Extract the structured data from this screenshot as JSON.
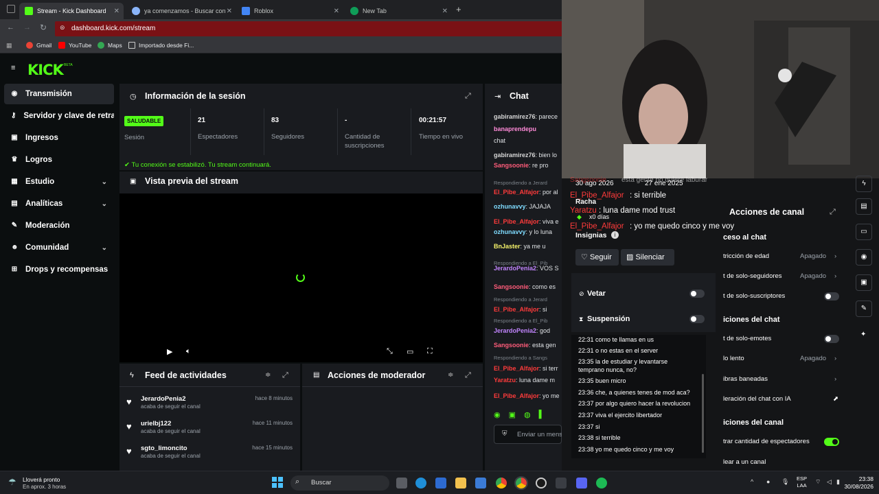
{
  "browser": {
    "tabs": [
      {
        "label": "Stream - Kick Dashboard",
        "icon": "kick-icon",
        "color": "#53fc18"
      },
      {
        "label": "ya comenzamos - Buscar con G",
        "icon": "search-icon",
        "color": "#8ab4f8"
      },
      {
        "label": "Roblox",
        "icon": "roblox-icon",
        "color": "#4285f4"
      },
      {
        "label": "New Tab",
        "icon": "newtab-icon",
        "color": "#0f9d58"
      }
    ],
    "url": "dashboard.kick.com/stream",
    "bookmarks": [
      "Gmail",
      "YouTube",
      "Maps",
      "Importado desde Fi..."
    ]
  },
  "kick": {
    "logo": "KICK",
    "logo_badge": "BETA",
    "nav": [
      {
        "label": "Transmisión",
        "icon": "broadcast-icon"
      },
      {
        "label": "Servidor y clave de retransmisión",
        "icon": "key-icon"
      },
      {
        "label": "Ingresos",
        "icon": "money-icon"
      },
      {
        "label": "Logros",
        "icon": "trophy-icon"
      },
      {
        "label": "Estudio",
        "icon": "studio-icon",
        "chev": "⌄"
      },
      {
        "label": "Analíticas",
        "icon": "chart-icon",
        "chev": "⌄"
      },
      {
        "label": "Moderación",
        "icon": "wrench-icon"
      },
      {
        "label": "Comunidad",
        "icon": "people-icon",
        "chev": "⌄"
      },
      {
        "label": "Drops y recompensas",
        "icon": "gift-icon"
      }
    ],
    "session": {
      "title": "Información de la sesión",
      "health_badge": "SALUDABLE",
      "health_label": "Sesión",
      "viewers_value": "21",
      "viewers_label": "Espectadores",
      "followers_value": "83",
      "followers_label": "Seguidores",
      "subs_value": "-",
      "subs_label": "Cantidad de suscripciones",
      "uptime_value": "00:21:57",
      "uptime_label": "Tiempo en vivo",
      "connection_msg": "Tu conexión se estabilizó. Tu stream continuará."
    },
    "preview": {
      "title": "Vista previa del stream"
    },
    "feed": {
      "title": "Feed de actividades",
      "items": [
        {
          "name": "JerardoPenia2",
          "sub": "acaba de seguir el canal",
          "time": "hace 8 minutos"
        },
        {
          "name": "urielbj122",
          "sub": "acaba de seguir el canal",
          "time": "hace 11 minutos"
        },
        {
          "name": "sgto_limoncito",
          "sub": "acaba de seguir el canal",
          "time": "hace 15 minutos"
        }
      ]
    },
    "mod_actions": {
      "title": "Acciones de moderador"
    },
    "chat": {
      "title": "Chat",
      "input_placeholder": "Enviar un mensaje",
      "messages": [
        {
          "user": "gabiramirez76",
          "text": ": parece",
          "color": "#d6d6d6",
          "reply": false
        },
        {
          "user": "banaprendepu",
          "text": "",
          "color": "#ff8ad8",
          "reply": false
        },
        {
          "user": "",
          "text": "chat",
          "color": "#d6d6d6",
          "reply": false
        },
        {
          "user": "gabiramirez76",
          "text": ": bien lo",
          "color": "#d6d6d6",
          "reply": false
        },
        {
          "user": "Sangsoonie",
          "text": ": re pro",
          "color": "#ff5c7a",
          "reply": false
        },
        {
          "user": "",
          "text": "Respondiendo a Jerard",
          "color": "#7c838a",
          "reply": true
        },
        {
          "user": "El_Pibe_Alfajor",
          "text": ": por al",
          "color": "#ff3b3b",
          "reply": false
        },
        {
          "user": "ozhunavvy",
          "text": ": JAJAJA",
          "color": "#7fdcff",
          "reply": false
        },
        {
          "user": "El_Pibe_Alfajor",
          "text": ": viva e",
          "color": "#ff3b3b",
          "reply": false
        },
        {
          "user": "ozhunavvy",
          "text": ": y lo luna",
          "color": "#7fdcff",
          "reply": false
        },
        {
          "user": "BnJaster",
          "text": ": ya me u",
          "color": "#f8f56b",
          "reply": false
        },
        {
          "user": "",
          "text": "Respondiendo a El_Pib",
          "color": "#7c838a",
          "reply": true
        },
        {
          "user": "JerardoPenia2",
          "text": ": VOS S",
          "color": "#c084fc",
          "reply": false
        },
        {
          "user": "Sangsoonie",
          "text": ": como es",
          "color": "#ff5c7a",
          "reply": false
        },
        {
          "user": "",
          "text": "Respondiendo a Jerard",
          "color": "#7c838a",
          "reply": true
        },
        {
          "user": "El_Pibe_Alfajor",
          "text": ": si",
          "color": "#ff3b3b",
          "reply": false
        },
        {
          "user": "",
          "text": "Respondiendo a El_Pib",
          "color": "#7c838a",
          "reply": true
        },
        {
          "user": "JerardoPenia2",
          "text": ": god",
          "color": "#c084fc",
          "reply": false
        },
        {
          "user": "Sangsoonie",
          "text": ": esta gen",
          "color": "#ff5c7a",
          "reply": false
        },
        {
          "user": "",
          "text": "Respondiendo a Sangs",
          "color": "#7c838a",
          "reply": true
        },
        {
          "user": "El_Pibe_Alfajor",
          "text": ": si terr",
          "color": "#ff3b3b",
          "reply": false
        },
        {
          "user": "Yaratzu",
          "text": ": luna dame m",
          "color": "#ff3b3b",
          "reply": false
        },
        {
          "user": "El_Pibe_Alfajor",
          "text": ": yo me",
          "color": "#ff3b3b",
          "reply": false
        }
      ]
    }
  },
  "user_card": {
    "dates": [
      "30 ago 2026",
      "27 ene 2025"
    ],
    "streak_label": "Racha",
    "streak_value": "x0 días",
    "badges_label": "Insignias",
    "follow_label": "Seguir",
    "silence_label": "Silenciar",
    "ban_label": "Vetar",
    "suspend_label": "Suspensión",
    "overlay_msgs": [
      {
        "user": "Sangsoonie",
        "text": "esta gente no quiere laburar"
      },
      {
        "user": "El_Pibe_Alfajor",
        "text": ": si terrible"
      },
      {
        "user": "Yaratzu",
        "text": ": luna dame mod trust"
      },
      {
        "user": "El_Pibe_Alfajor",
        "text": ": yo me quedo cinco y me voy"
      }
    ],
    "log": [
      "22:31 como te llamas en us",
      "22:31 o no estas en el server",
      "23:35 la de estudiar y levantarse",
      "temprano nunca, no?",
      "23:35 buen micro",
      "23:36 che, a quienes tenes de mod aca?",
      "23:37 por algo quiero hacer la revolucion",
      "23:37 viva el ejercito libertador",
      "23:37 si",
      "23:38 si terrible",
      "23:38 yo me quedo cinco y me voy"
    ]
  },
  "channel_actions": {
    "title": "Acciones de canal",
    "rows": [
      {
        "label": "ceso al chat",
        "kind": "section"
      },
      {
        "label": "tricción de edad",
        "value": "Apagado",
        "kind": "select"
      },
      {
        "label": "t de solo-seguidores",
        "value": "Apagado",
        "kind": "select"
      },
      {
        "label": "t de solo-suscriptores",
        "kind": "toggle"
      },
      {
        "label": "iciones del chat",
        "kind": "section"
      },
      {
        "label": "t de solo-emotes",
        "kind": "toggle"
      },
      {
        "label": "lo lento",
        "value": "Apagado",
        "kind": "select"
      },
      {
        "label": "ibras baneadas",
        "kind": "link"
      },
      {
        "label": "leración del chat con IA",
        "kind": "external"
      },
      {
        "label": "iciones del canal",
        "kind": "section"
      },
      {
        "label": "trar cantidad de espectadores",
        "kind": "toggle-on"
      },
      {
        "label": "lear a un canal",
        "kind": "plain"
      }
    ]
  },
  "taskbar": {
    "weather_title": "Lloverá pronto",
    "weather_sub": "En aprox. 3 horas",
    "search_placeholder": "Buscar",
    "lang": "ESP",
    "lang2": "LAA",
    "time": "23:38",
    "date": "30/08/2026"
  }
}
